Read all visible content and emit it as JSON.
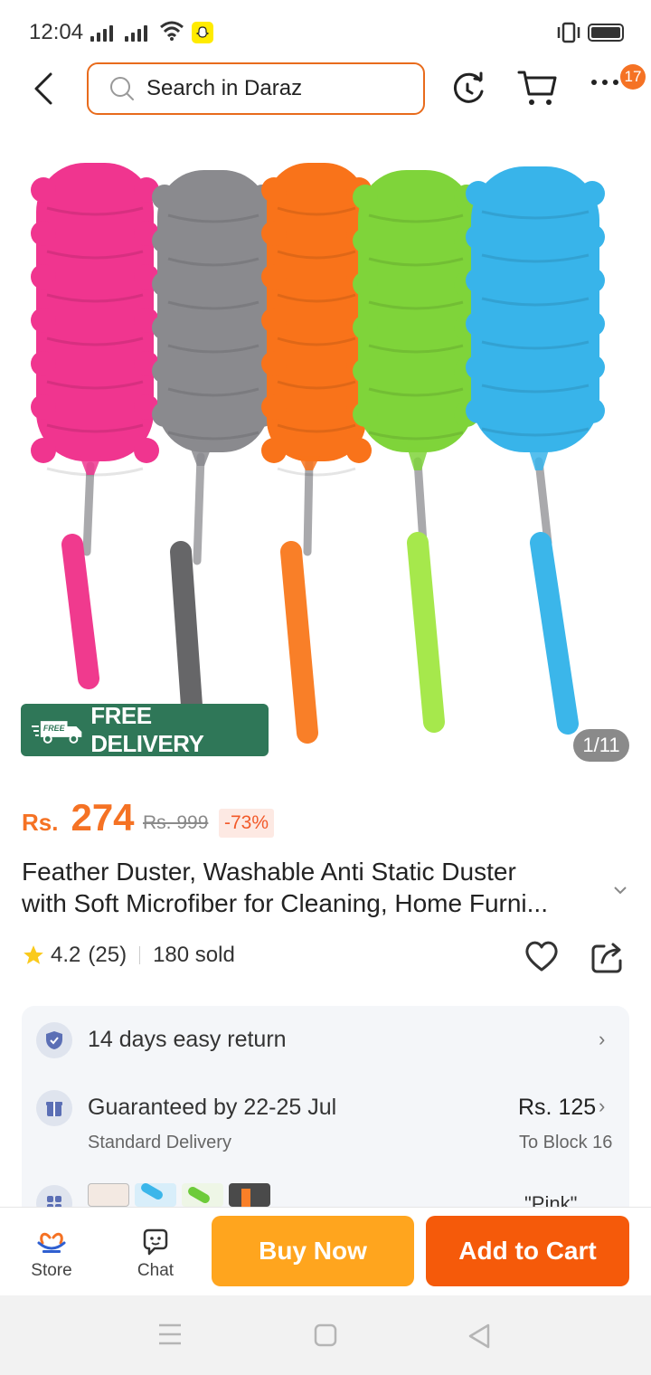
{
  "status_bar": {
    "time": "12:04"
  },
  "header": {
    "search_placeholder": "Search in Daraz",
    "cart_badge": "17"
  },
  "product_image": {
    "badge_text": "FREE DELIVERY",
    "badge_small": "FREE",
    "pager": "1/11",
    "duster_colors": [
      "#f0358f",
      "#8a8a8e",
      "#f9731a",
      "#7fd43a",
      "#38b4ea"
    ],
    "handle_colors": [
      "#f03a8e",
      "#666668",
      "#f97f28",
      "#a6e84c",
      "#3bb6ea"
    ]
  },
  "price": {
    "currency": "Rs.",
    "value": "274",
    "original": "Rs. 999",
    "discount": "-73%"
  },
  "title": {
    "line1": "Feather Duster, Washable Anti Static Duster",
    "line2": "with Soft Microfiber for Cleaning, Home Furni..."
  },
  "rating": {
    "score": "4.2",
    "count": "(25)",
    "sold": "180 sold"
  },
  "info": {
    "return_text": "14 days easy return",
    "delivery_title": "Guaranteed by 22-25 Jul",
    "delivery_sub": "Standard Delivery",
    "delivery_price": "Rs. 125",
    "delivery_to": "To Block 16",
    "variant_text": "\"Pink\""
  },
  "bottom": {
    "store_label": "Store",
    "chat_label": "Chat",
    "buy_now": "Buy Now",
    "add_to_cart": "Add to Cart"
  },
  "colors": {
    "accent": "#f57224",
    "buy": "#ffa51e",
    "add": "#f55a0a",
    "delivery_badge": "#2f7758"
  }
}
